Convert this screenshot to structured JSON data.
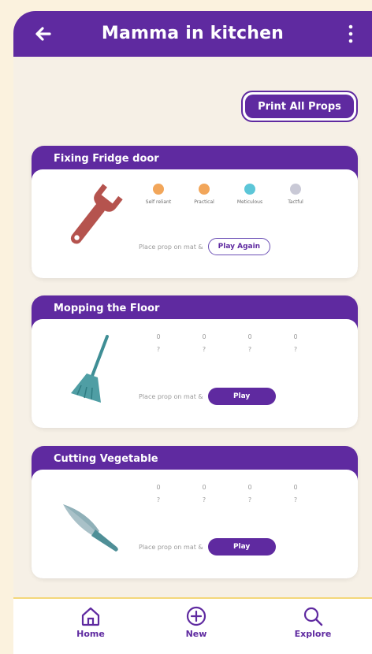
{
  "header": {
    "title": "Mamma in kitchen"
  },
  "toolbar": {
    "print_label": "Print All Props"
  },
  "traits": [
    "Self reliant",
    "Practical",
    "Meticulous",
    "Tactful"
  ],
  "trait_colors": [
    "#f2a65a",
    "#f2a65a",
    "#5cc6d8",
    "#c9c9d6"
  ],
  "empty_value": "0",
  "empty_mark": "?",
  "cards": [
    {
      "title": "Fixing Fridge door",
      "place_text": "Place prop on mat &",
      "action": "Play Again",
      "icon": "wrench-icon"
    },
    {
      "title": "Mopping the Floor",
      "place_text": "Place prop on mat &",
      "action": "Play",
      "icon": "broom-icon"
    },
    {
      "title": "Cutting Vegetable",
      "place_text": "Place prop on mat &",
      "action": "Play",
      "icon": "knife-icon"
    }
  ],
  "nav": [
    {
      "label": "Home",
      "icon": "home-icon"
    },
    {
      "label": "New",
      "icon": "plus-circle-icon"
    },
    {
      "label": "Explore",
      "icon": "search-icon"
    }
  ],
  "colors": {
    "brand": "#5f2aa0",
    "background": "#fbf2de",
    "divider": "#f3d77a"
  }
}
